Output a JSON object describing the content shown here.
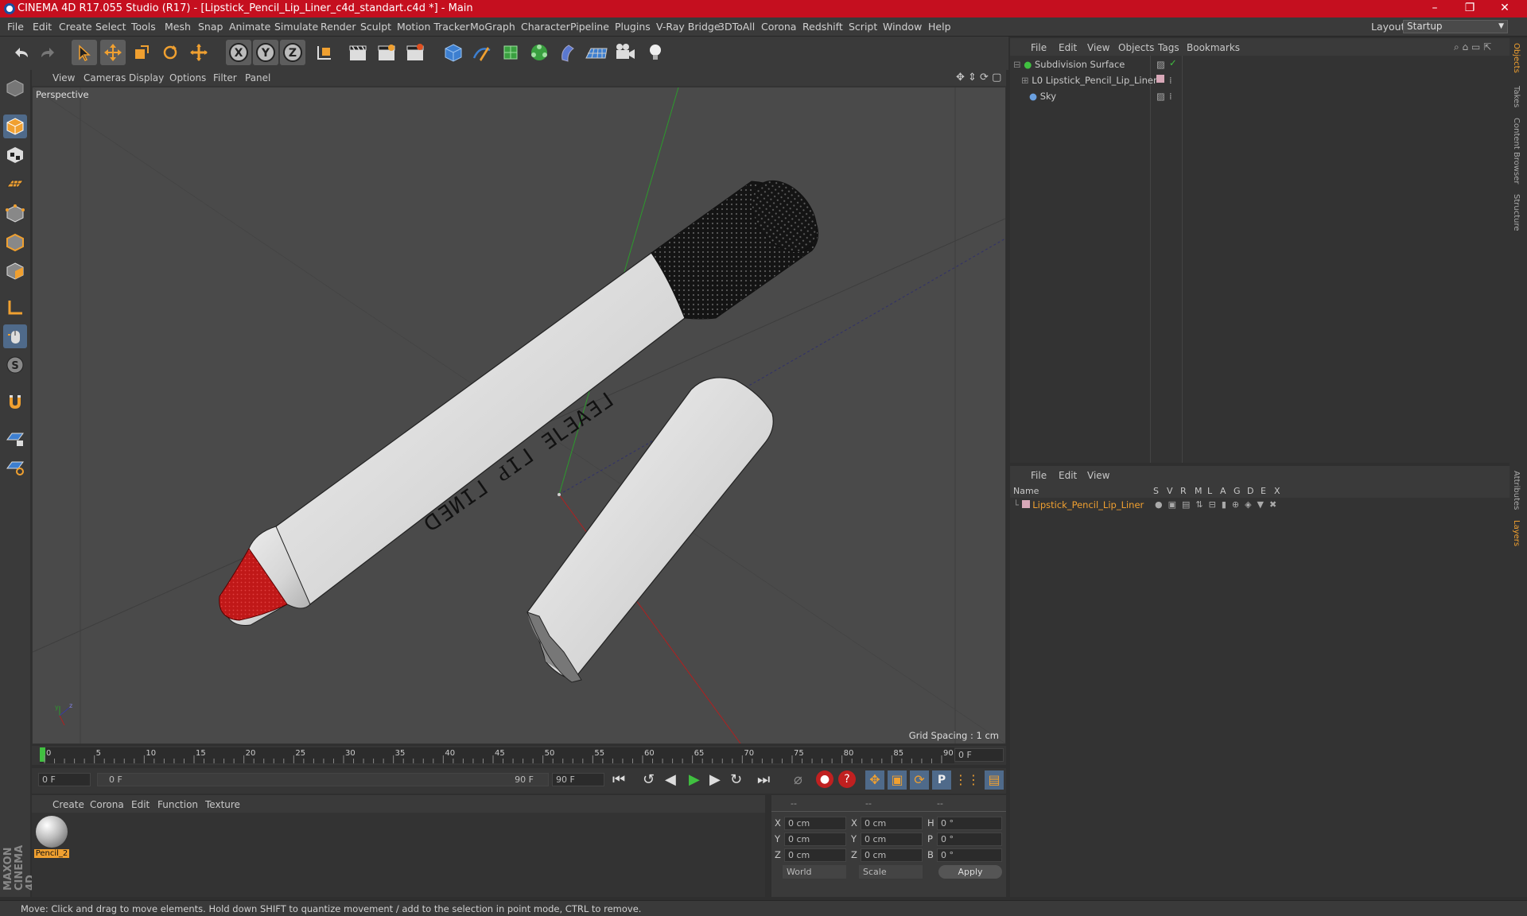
{
  "window": {
    "title": "CINEMA 4D R17.055 Studio (R17) - [Lipstick_Pencil_Lip_Liner_c4d_standart.c4d *] - Main",
    "controls": [
      "–",
      "❐",
      "✕"
    ]
  },
  "menubar": {
    "items": [
      "File",
      "Edit",
      "Create",
      "Select",
      "Tools",
      "Mesh",
      "Snap",
      "Animate",
      "Simulate",
      "Render",
      "Sculpt",
      "Motion Tracker",
      "MoGraph",
      "Character",
      "Pipeline",
      "Plugins",
      "V-Ray Bridge",
      "3DToAll",
      "Corona",
      "Redshift",
      "Script",
      "Window",
      "Help"
    ],
    "layout_label": "Layout:",
    "layout_value": "Startup"
  },
  "viewport": {
    "menu": [
      "View",
      "Cameras",
      "Display",
      "Options",
      "Filter",
      "Panel"
    ],
    "label": "Perspective",
    "grid_spacing": "Grid Spacing : 1 cm",
    "pencil_print": "ᗡƎИIᒧ ԀIᒧ ƎᒪƎAƎᒧ"
  },
  "timeline": {
    "ticks": [
      "0",
      "5",
      "10",
      "15",
      "20",
      "25",
      "30",
      "35",
      "40",
      "45",
      "50",
      "55",
      "60",
      "65",
      "70",
      "75",
      "80",
      "85",
      "90"
    ],
    "current_frame": "0 F"
  },
  "transport": {
    "start_field": "0 F",
    "range_start": "0 F",
    "range_end": "90 F",
    "end_field": "90 F"
  },
  "materials": {
    "menu": [
      "Create",
      "Corona",
      "Edit",
      "Function",
      "Texture"
    ],
    "items": [
      {
        "name": "Pencil_2"
      }
    ]
  },
  "coordinates": {
    "headers": [
      "--",
      "--",
      "--"
    ],
    "rows": [
      {
        "a": "X",
        "av": "0 cm",
        "b": "X",
        "bv": "0 cm",
        "c": "H",
        "cv": "0 °"
      },
      {
        "a": "Y",
        "av": "0 cm",
        "b": "Y",
        "bv": "0 cm",
        "c": "P",
        "cv": "0 °"
      },
      {
        "a": "Z",
        "av": "0 cm",
        "b": "Z",
        "bv": "0 cm",
        "c": "B",
        "cv": "0 °"
      }
    ],
    "mode1": "World",
    "mode2": "Scale",
    "apply": "Apply"
  },
  "objects": {
    "menu": [
      "File",
      "Edit",
      "View",
      "Objects",
      "Tags",
      "Bookmarks"
    ],
    "items": [
      {
        "name": "Subdivision Surface"
      },
      {
        "name": "Lipstick_Pencil_Lip_Liner"
      },
      {
        "name": "Sky"
      }
    ]
  },
  "layers": {
    "menu": [
      "File",
      "Edit",
      "View"
    ],
    "columns": [
      "Name",
      "S",
      "V",
      "R",
      "M",
      "L",
      "A",
      "G",
      "D",
      "E",
      "X"
    ],
    "items": [
      {
        "name": "Lipstick_Pencil_Lip_Liner"
      }
    ]
  },
  "right_tabs": [
    "Objects",
    "Takes",
    "Content Browser",
    "Structure",
    "Attributes",
    "Layers"
  ],
  "status": "Move: Click and drag to move elements. Hold down SHIFT to quantize movement / add to the selection in point mode, CTRL to remove.",
  "colors": {
    "title_bar": "#c50f1f",
    "accent_orange": "#f0a030",
    "tool_blue": "#3d7fd0",
    "pencil_red": "#c01818"
  }
}
